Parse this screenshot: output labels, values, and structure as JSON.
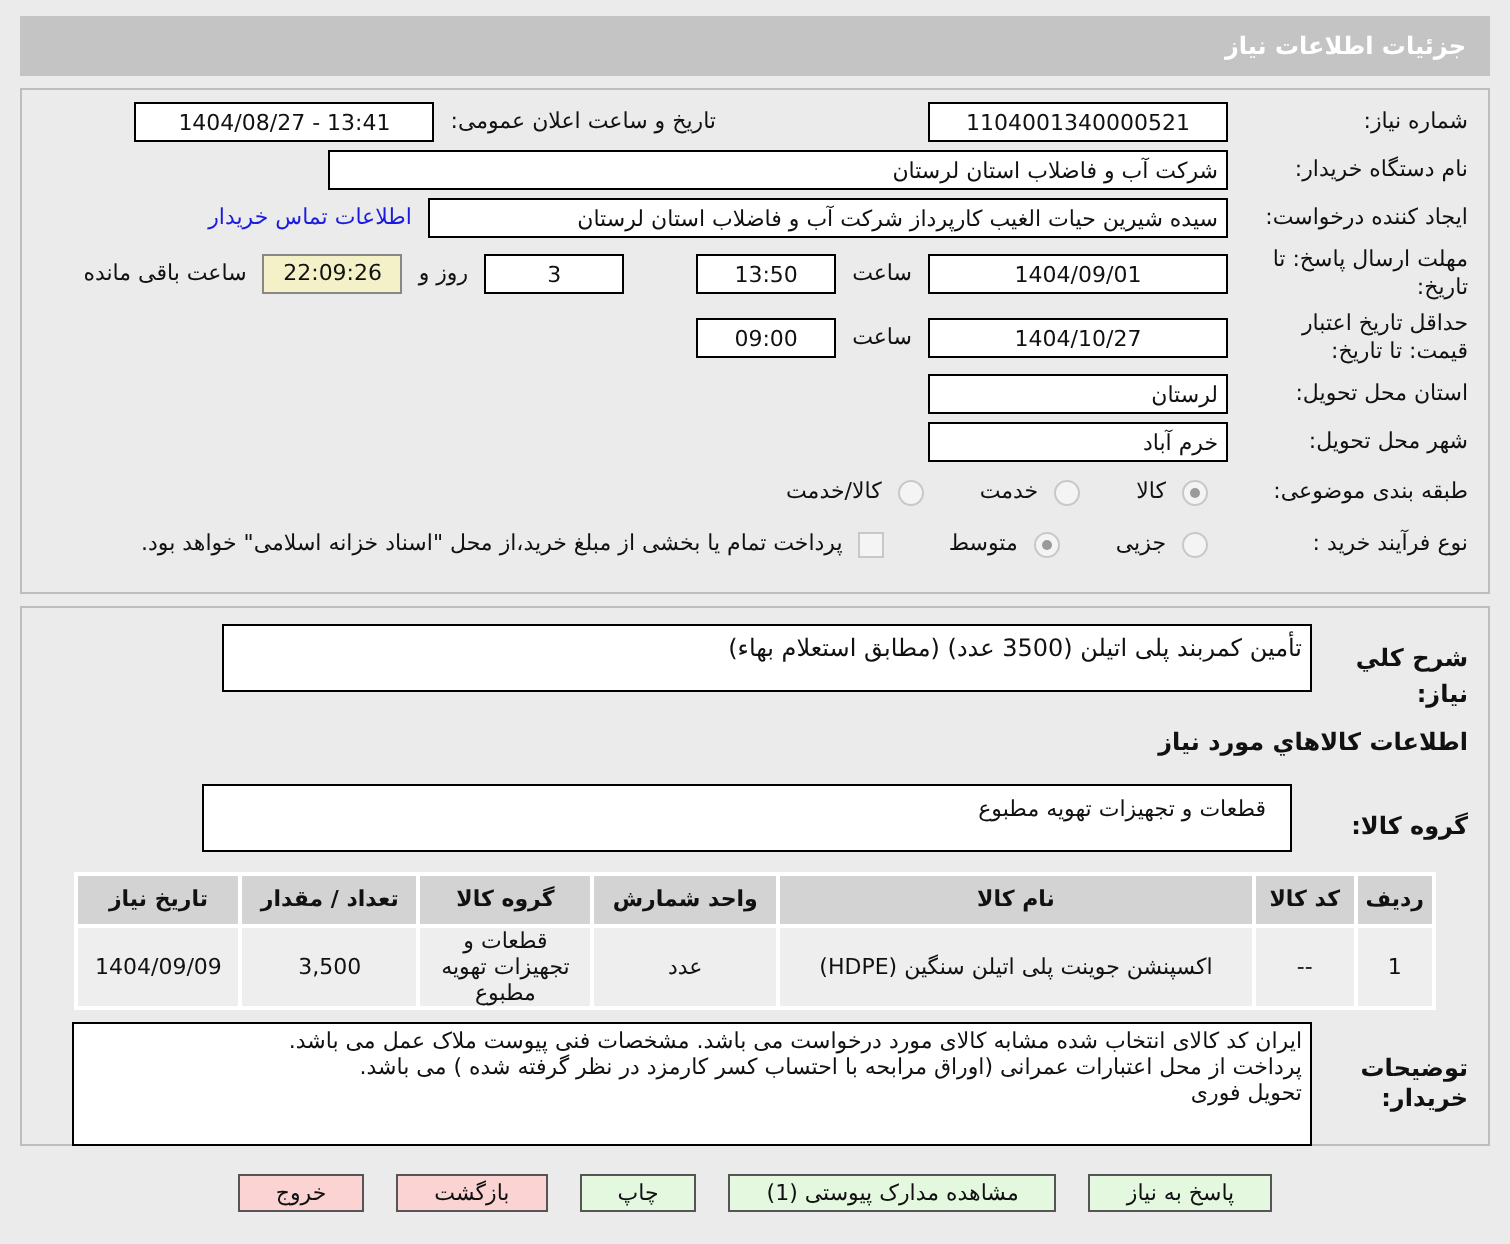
{
  "title": "جزئیات اطلاعات نیاز",
  "need_number": {
    "label": "شماره نیاز:",
    "value": "1104001340000521"
  },
  "announce": {
    "label": "تاریخ و ساعت اعلان عمومی:",
    "value": "1404/08/27 - 13:41"
  },
  "buyer": {
    "label": "نام دستگاه خریدار:",
    "value": "شرکت آب و فاضلاب استان لرستان"
  },
  "creator": {
    "label": "ایجاد کننده درخواست:",
    "value": "سیده شیرین حیات الغیب کارپرداز شرکت آب و فاضلاب استان لرستان",
    "link": "اطلاعات تماس خریدار"
  },
  "deadline": {
    "label": "مهلت ارسال پاسخ: تا تاریخ:",
    "date": "1404/09/01",
    "time_label": "ساعت",
    "time": "13:50",
    "days": "3",
    "days_label": "روز و",
    "remaining": "22:09:26",
    "remaining_label": "ساعت باقی مانده"
  },
  "validity": {
    "label": "حداقل تاریخ اعتبار قیمت: تا تاریخ:",
    "date": "1404/10/27",
    "time_label": "ساعت",
    "time": "09:00"
  },
  "province": {
    "label": "استان محل تحویل:",
    "value": "لرستان"
  },
  "city": {
    "label": "شهر محل تحویل:",
    "value": "خرم آباد"
  },
  "category": {
    "label": "طبقه بندی موضوعی:",
    "options": [
      {
        "label": "کالا",
        "selected": true
      },
      {
        "label": "خدمت",
        "selected": false
      },
      {
        "label": "کالا/خدمت",
        "selected": false
      }
    ]
  },
  "process": {
    "label": "نوع فرآیند خرید :",
    "options": [
      {
        "label": "جزیی",
        "selected": false
      },
      {
        "label": "متوسط",
        "selected": true
      }
    ],
    "payment": {
      "checked": false,
      "text": "پرداخت تمام یا بخشی از مبلغ خرید،از محل \"اسناد خزانه اسلامی\" خواهد بود."
    }
  },
  "summary": {
    "label": "شرح کلي نياز:",
    "value": "تأمین کمربند پلی اتیلن (3500 عدد) (مطابق استعلام بهاء)"
  },
  "goods_heading": "اطلاعات کالاهاي مورد نياز",
  "goods_group": {
    "label": "گروه کالا:",
    "value": "قطعات و تجهیزات تهویه مطبوع"
  },
  "table": {
    "columns": [
      "ردیف",
      "کد کالا",
      "نام کالا",
      "واحد شمارش",
      "گروه کالا",
      "تعداد / مقدار",
      "تاریخ نیاز"
    ],
    "rows": [
      [
        "1",
        "--",
        "اکسپنشن جوینت پلی اتیلن سنگین (HDPE)",
        "عدد",
        "قطعات و تجهیزات تهویه مطبوع",
        "3,500",
        "1404/09/09"
      ]
    ]
  },
  "notes": {
    "label": "توضیحات خریدار:",
    "lines": [
      "ایران کد کالای انتخاب شده مشابه کالای مورد درخواست می باشد. مشخصات فنی پیوست ملاک عمل می باشد.",
      "پرداخت از محل اعتبارات عمرانی (اوراق مرابحه با احتساب کسر کارمزد در نظر گرفته شده ) می باشد.",
      "تحویل فوری"
    ]
  },
  "buttons": [
    {
      "label": "پاسخ به نیاز",
      "kind": "normal"
    },
    {
      "label": "مشاهده مدارک پیوستی (1)",
      "kind": "normal"
    },
    {
      "label": "چاپ",
      "kind": "normal"
    },
    {
      "label": "بازگشت",
      "kind": "danger"
    },
    {
      "label": "خروج",
      "kind": "danger"
    }
  ]
}
